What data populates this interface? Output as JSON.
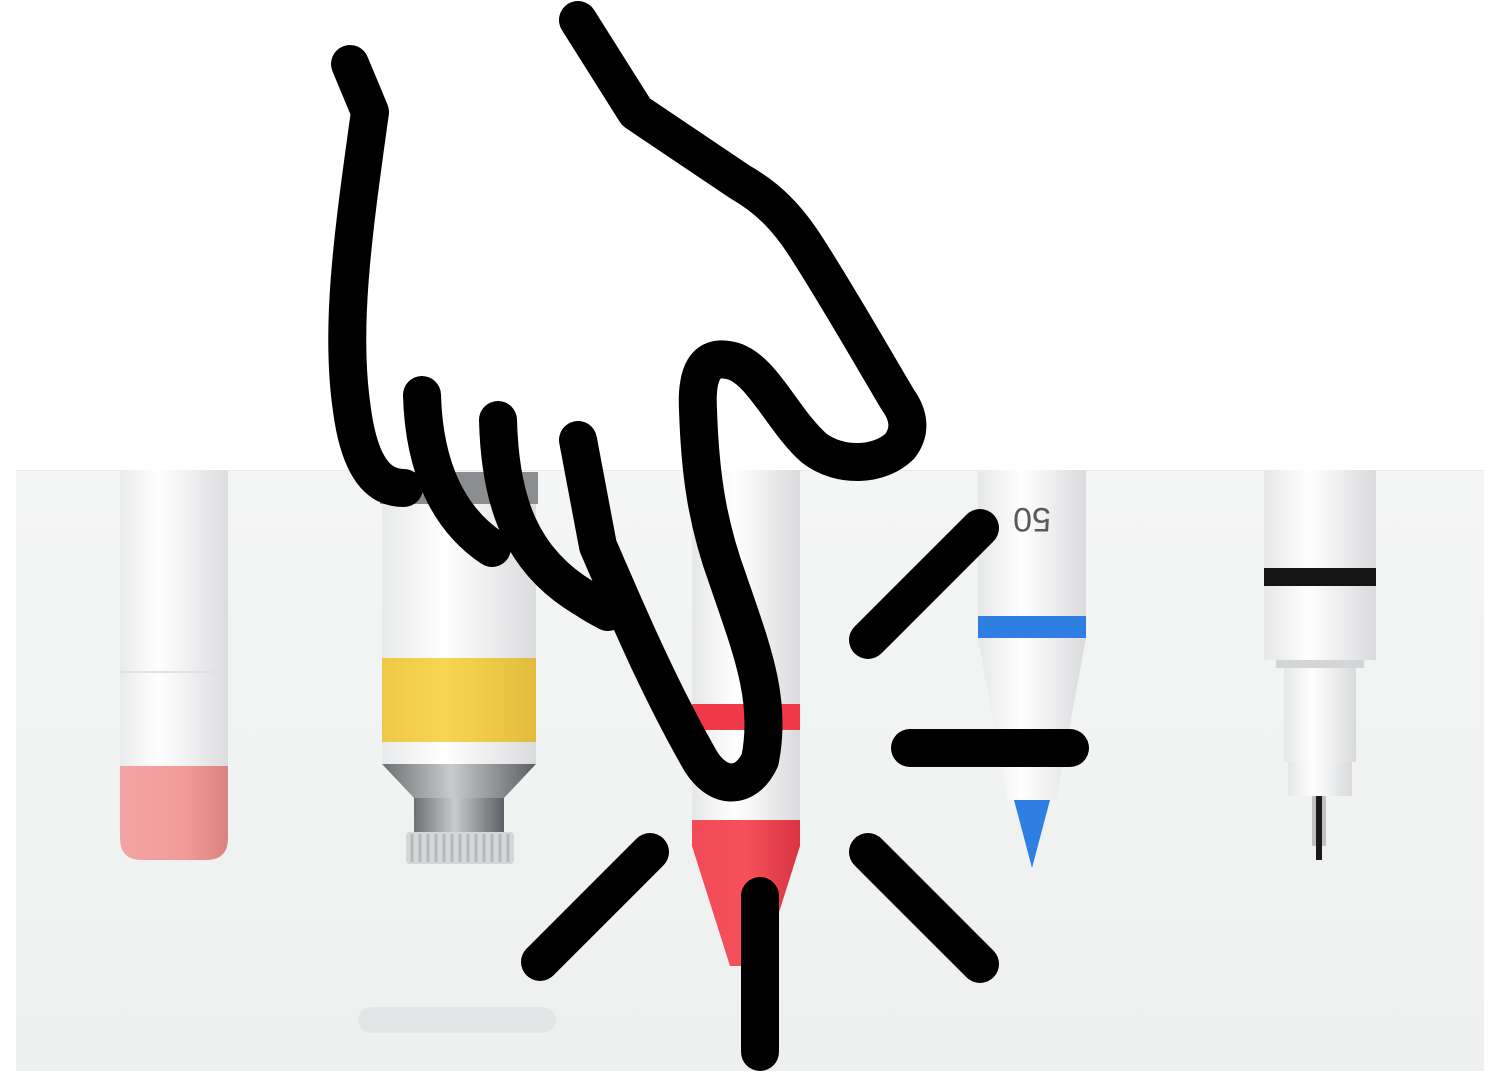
{
  "toolbar": {
    "tools": [
      {
        "id": "eraser",
        "accent": "#f29a9a"
      },
      {
        "id": "paint-tube",
        "accent": "#f5d248"
      },
      {
        "id": "marker",
        "accent": "#f0404e",
        "selected": true
      },
      {
        "id": "pen",
        "accent": "#2f7fe3",
        "size_label": "50"
      },
      {
        "id": "fineliner",
        "accent": "#111111"
      }
    ]
  },
  "gesture": {
    "icon": "tap-hand-icon",
    "target": "marker"
  }
}
